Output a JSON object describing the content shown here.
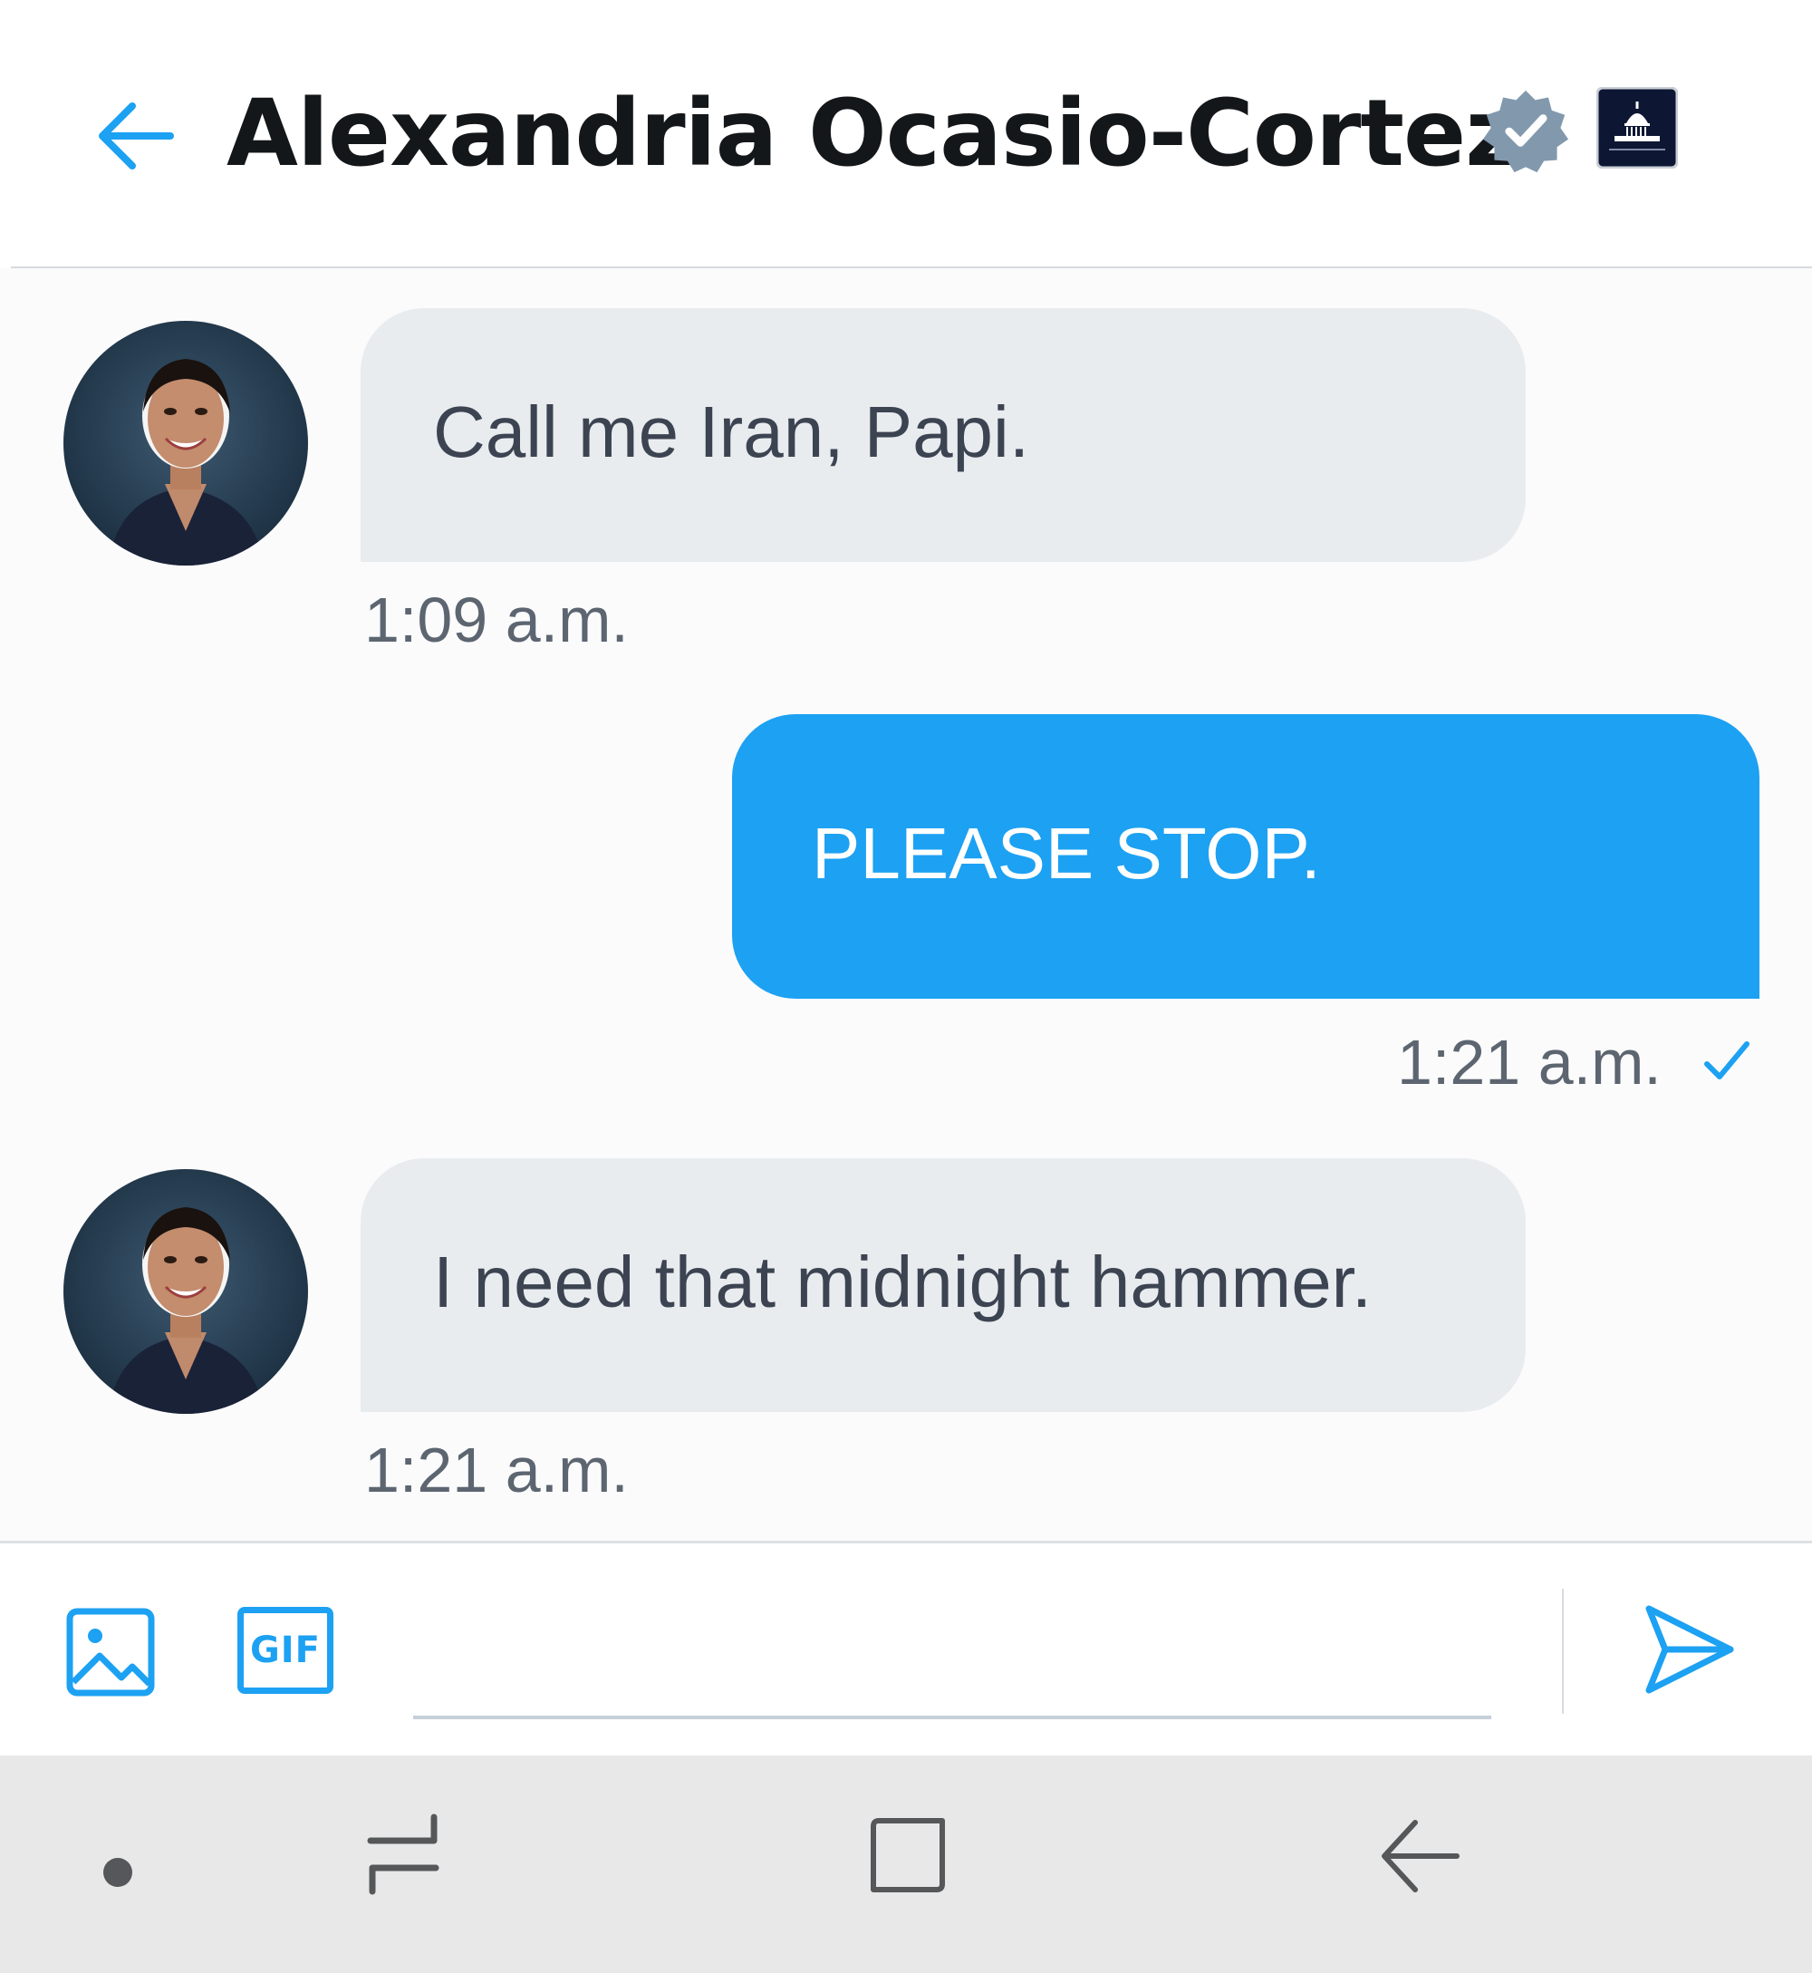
{
  "header": {
    "back_label": "back",
    "title": "Alexandria Ocasio-Cortez",
    "verified_icon": "verified-badge-icon",
    "affiliation_icon": "capitol-building-icon"
  },
  "conversation": {
    "messages": [
      {
        "direction": "received",
        "text": "Call me Iran, Papi.",
        "time": "1:09 a.m."
      },
      {
        "direction": "sent",
        "text": "PLEASE STOP.",
        "time": "1:21 a.m.",
        "status_icon": "read-check-icon"
      },
      {
        "direction": "received",
        "text": "I need that midnight hammer.",
        "time": "1:21 a.m."
      }
    ]
  },
  "composer": {
    "media_icon": "image-icon",
    "gif_label": "GIF",
    "input_value": "",
    "input_placeholder": "",
    "send_icon": "send-icon"
  },
  "system_nav": {
    "items": [
      "dot-indicator-icon",
      "recent-apps-icon",
      "home-icon",
      "back-icon"
    ]
  },
  "colors": {
    "accent": "#1da1f2",
    "received_bubble": "#e9ecef",
    "received_text": "#3c4452",
    "timestamp": "#5c6570",
    "title_text": "#14171a",
    "navbar_bg": "#e8e8e9"
  }
}
